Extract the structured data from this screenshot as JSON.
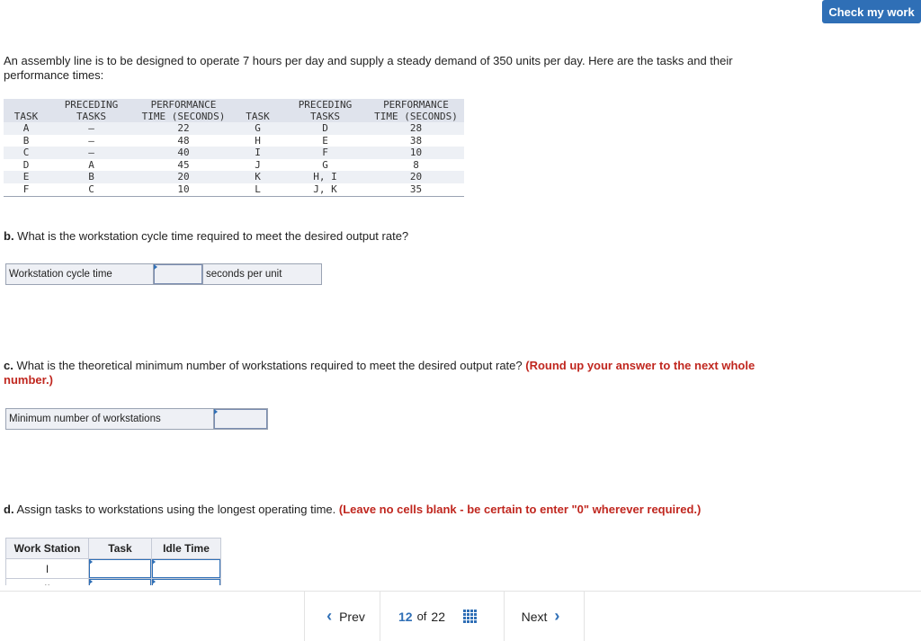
{
  "header": {
    "check_label": "Check my work"
  },
  "intro": "An assembly line is to be designed to operate 7 hours per day and supply a steady demand of 350 units per day. Here are the tasks and their performance times:",
  "task_table": {
    "headers": {
      "task": "TASK",
      "preceding_l1": "PRECEDING",
      "preceding_l2": "TASKS",
      "performance_l1": "PERFORMANCE",
      "performance_l2": "TIME (SECONDS)"
    },
    "rows": [
      {
        "t1": "A",
        "p1": "—",
        "s1": "22",
        "t2": "G",
        "p2": "D",
        "s2": "28"
      },
      {
        "t1": "B",
        "p1": "—",
        "s1": "48",
        "t2": "H",
        "p2": "E",
        "s2": "38"
      },
      {
        "t1": "C",
        "p1": "—",
        "s1": "40",
        "t2": "I",
        "p2": "F",
        "s2": "10"
      },
      {
        "t1": "D",
        "p1": "A",
        "s1": "45",
        "t2": "J",
        "p2": "G",
        "s2": "8"
      },
      {
        "t1": "E",
        "p1": "B",
        "s1": "20",
        "t2": "K",
        "p2": "H, I",
        "s2": "20"
      },
      {
        "t1": "F",
        "p1": "C",
        "s1": "10",
        "t2": "L",
        "p2": "J, K",
        "s2": "35"
      }
    ]
  },
  "qb": {
    "prefix": "b.",
    "text": " What is the workstation cycle time required to meet the desired output rate?",
    "label": "Workstation cycle time",
    "value": "",
    "unit": "seconds per unit"
  },
  "qc": {
    "prefix": "c.",
    "text": " What is the theoretical minimum number of workstations required to meet the desired output rate? ",
    "note": "(Round up your answer to the next whole number.)",
    "label": "Minimum number of workstations",
    "value": ""
  },
  "qd": {
    "prefix": "d.",
    "text": " Assign tasks to workstations using the longest operating time. ",
    "note": "(Leave no cells blank - be certain to enter \"0\" wherever required.)",
    "table_headers": [
      "Work Station",
      "Task",
      "Idle Time"
    ],
    "rows": [
      {
        "station": "I",
        "task": "",
        "idle": ""
      },
      {
        "station": "II",
        "task": "",
        "idle": ""
      }
    ]
  },
  "nav": {
    "prev_label": "Prev",
    "current": "12",
    "of_label": "of",
    "total": "22",
    "next_label": "Next"
  },
  "colors": {
    "accent": "#2f6fb6",
    "emphasis": "#c0271f"
  }
}
